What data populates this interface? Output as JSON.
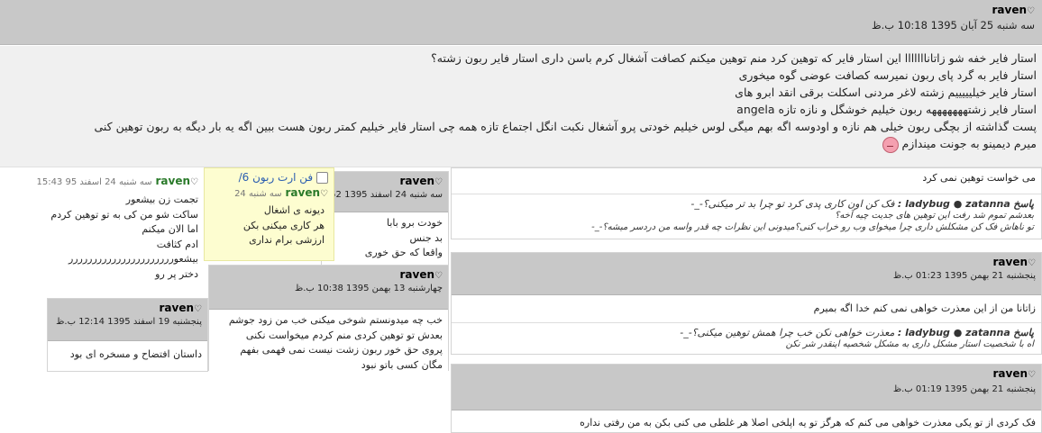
{
  "main_post": {
    "username": "raven",
    "heart": "♡",
    "date": "سه شنبه 25 آبان 1395 10:18 ب.ظ",
    "lines": [
      "استار فایر خفه شو زاتانااااااا این استار فایر که توهین کرد منم توهین میکنم کصافت آشغال کرم باسن داری استار فایر ربون زشته؟",
      "استار فایر به گرد پای ربون نمیرسه کصافت عوضی گوه میخوری",
      "استار فایر خیلیییییم زشته لاغر مردنی اسکلت برقی انقد ابرو های",
      "استار فایر زشتهههههههه ربون خیلیم خوشگل و نازه تازه angela",
      "پست گذاشته از بچگی ربون خیلی هم نازه و اودوسه اگه بهم میگی لوس خیلیم خودتی پرو آشغال نکبت انگل اجتماع تازه همه چی استار فایر خیلیم کمتر ربون هست ببین اگه یه بار دیگه به ربون توهین کنی",
      "میرم دیمینو به جونت میندازم"
    ]
  },
  "right_col": {
    "top_text": "می خواست توهین نمی کرد",
    "reply1": {
      "label": "پاسخ",
      "author": "ladybug ● zatanna :",
      "lines": [
        "فک کن اون کاری پدی کرد تو چرا بد تر میکنی؟-_-",
        "بعدشم تموم شد رفت این توهین های جدیت چیه آخه؟",
        "تو ناهاش فک کن مشکلش داری چرا میخوای وب رو خراب کنی؟میدونی این نظرات چه قدر واسه من دردسر میشه؟-_-"
      ]
    },
    "card2": {
      "username": "raven",
      "heart": "♡",
      "date": "پنجشنبه 21 بهمن 1395 01:23 ب.ظ",
      "body": "زاتانا من از این معذرت خواهی نمی کنم خدا اگه بمیرم",
      "reply": {
        "label": "پاسخ",
        "author": "ladybug ● zatanna :",
        "lines": [
          "معذرت خواهی نکن خب چرا همش توهین میکنی؟-_-",
          "اه با شخصیت استار مشکل داری به مشکل شخصیه اینقدر شر نکن"
        ]
      }
    },
    "card3": {
      "username": "raven",
      "heart": "♡",
      "date": "پنجشنبه 21 بهمن 1395 01:19 ب.ظ",
      "body": "فک کردی از تو یکی معذرت خواهی می کنم که هرگز تو یه اپلخی اصلا هر غلطی می کنی بکن به من رفتی نداره"
    }
  },
  "mid_a": {
    "username": "raven",
    "heart": "♡",
    "date": "سه شنبه 24 اسفند 1395 52",
    "lines": [
      "خودت برو بابا",
      "بد جنس",
      "واقعا که حق خوری"
    ]
  },
  "yellow": {
    "link": "فن ارت ربون 6/",
    "username": "raven",
    "heart": "♡",
    "date": "سه شنبه 24",
    "lines": [
      "دیونه ی اشغال",
      "هر کاری میکنی بکن",
      "ارزشی برام نداری"
    ]
  },
  "left_a": {
    "username": "raven",
    "heart": "♡",
    "date": "سه شنبه 24 اسفند 95 15:43",
    "lines": [
      "تجمت زن بیشعور",
      "ساکت شو من کی به تو توهین کردم",
      "اما الان میکنم",
      "ادم کثافت",
      "بیشعورررررررررررررررررررررر",
      "دختر پر رو"
    ]
  },
  "mid_b": {
    "username": "raven",
    "heart": "♡",
    "date": "چهارشنبه 13 بهمن 1395 10:38 ب.ظ",
    "lines": [
      "خب چه میدونستم شوخی میکنی خب من زود جوشم",
      "بعدش تو توهین کردی منم کردم میخواست نکنی",
      "پروی حق خور ربون زشت نیست نمی فهمی بفهم",
      "مگان کسی باتو نبود"
    ]
  },
  "left_b": {
    "username": "raven",
    "heart": "♡",
    "date": "پنجشنبه 19 اسفند 1395 12:14 ب.ظ",
    "body": "داستان افتضاح و مسخره ای بود"
  }
}
